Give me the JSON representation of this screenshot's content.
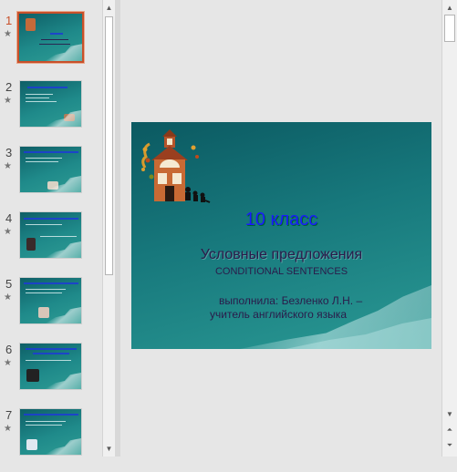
{
  "thumbnails": [
    {
      "number": "1",
      "star": "★"
    },
    {
      "number": "2",
      "star": "★"
    },
    {
      "number": "3",
      "star": "★"
    },
    {
      "number": "4",
      "star": "★"
    },
    {
      "number": "5",
      "star": "★"
    },
    {
      "number": "6",
      "star": "★"
    },
    {
      "number": "7",
      "star": "★"
    }
  ],
  "selected_slide": 1,
  "slide": {
    "title": "10 класс",
    "subtitle": "Условные предложения",
    "subtitle_en": "CONDITIONAL SENTENCES",
    "author_line1": "выполнила: Безленко Л.Н. –",
    "author_line2": "учитель английского языка"
  },
  "scroll": {
    "up": "▲",
    "down": "▼",
    "page_up": "⏶",
    "page_down": "⏷"
  },
  "colors": {
    "accent": "#c8502a",
    "slide_bg": "#17787c",
    "title": "#1a1aff"
  }
}
